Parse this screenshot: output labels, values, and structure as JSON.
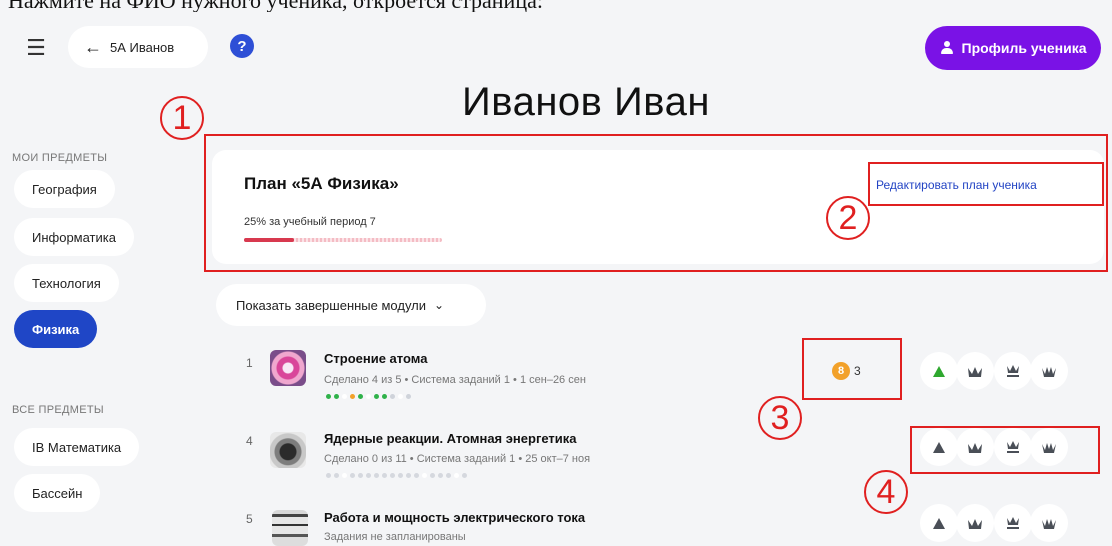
{
  "caption": "Нажмите на ФИО нужного ученика, откроется страница:",
  "header": {
    "back_label": "5А Иванов",
    "profile_button": "Профиль ученика"
  },
  "student_name": "Иванов Иван",
  "sidebar": {
    "my_subjects_label": "МОИ ПРЕДМЕТЫ",
    "my_subjects": [
      "География",
      "Информатика",
      "Технология",
      "Физика"
    ],
    "active_subject": "Физика",
    "all_subjects_label": "ВСЕ ПРЕДМЕТЫ",
    "all_subjects": [
      "IB Математика",
      "Бассейн"
    ]
  },
  "plan": {
    "title": "План «5А Физика»",
    "progress_text": "25% за учебный период 7",
    "progress_fraction": 0.25,
    "edit_link": "Редактировать план ученика"
  },
  "filter": {
    "label": "Показать завершенные модули"
  },
  "modules": [
    {
      "number": "1",
      "title": "Строение атома",
      "meta": "Сделано 4 из 5 • Система заданий 1 • 1 сен–26 сен",
      "coins": "3"
    },
    {
      "number": "4",
      "title": "Ядерные реакции. Атомная энергетика",
      "meta": "Сделано 0 из 11 • Система заданий 1 • 25 окт–7 ноя"
    },
    {
      "number": "5",
      "title": "Работа и мощность электрического тока",
      "meta": "Задания не запланированы"
    }
  ],
  "annotations": [
    "1",
    "2",
    "3",
    "4"
  ],
  "colors": {
    "accent_purple": "#7a12e6",
    "accent_blue": "#1f46c6",
    "annotation_red": "#e02020",
    "progress_red": "#d8394f",
    "coin_orange": "#f2a12a",
    "level_green": "#2fa82f"
  },
  "icons": {
    "menu": "hamburger-icon",
    "back": "arrow-left-icon",
    "help": "question-icon",
    "profile": "person-icon",
    "filter": "chevron-down-icon",
    "levels": [
      "triangle-level-icon",
      "crown-1-icon",
      "crown-2-icon",
      "crown-3-icon"
    ]
  }
}
